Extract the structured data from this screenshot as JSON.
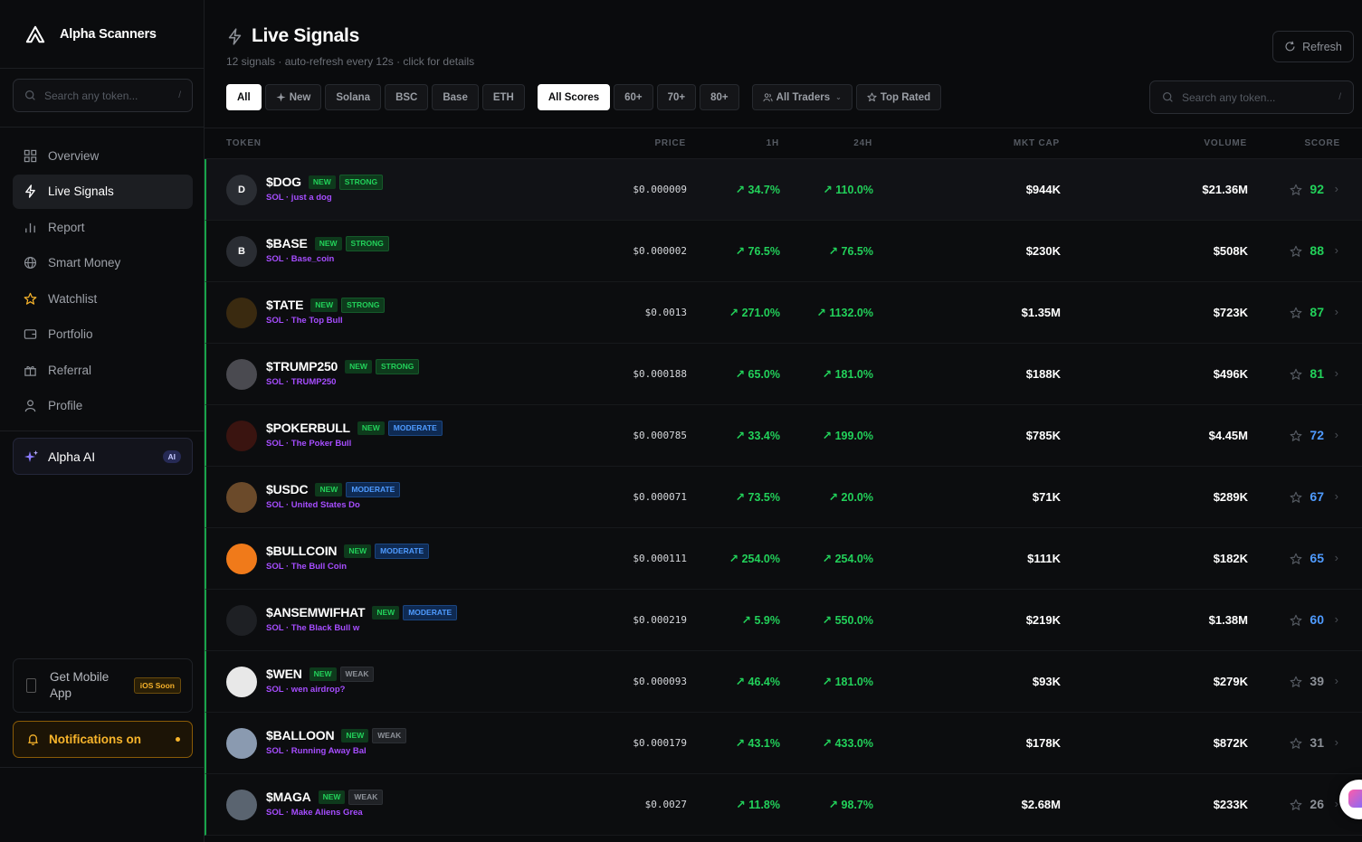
{
  "brand": {
    "name": "Alpha Scanners"
  },
  "sidebar": {
    "search_placeholder": "Search any token...",
    "search_kbd": "/",
    "nav": [
      {
        "label": "Overview",
        "icon": "grid-icon"
      },
      {
        "label": "Live Signals",
        "icon": "lightning-icon",
        "active": true
      },
      {
        "label": "Report",
        "icon": "bar-chart-icon"
      },
      {
        "label": "Smart Money",
        "icon": "globe-icon"
      },
      {
        "label": "Watchlist",
        "icon": "star-icon"
      },
      {
        "label": "Portfolio",
        "icon": "wallet-icon"
      },
      {
        "label": "Referral",
        "icon": "gift-icon"
      },
      {
        "label": "Profile",
        "icon": "user-icon"
      }
    ],
    "alpha_ai": {
      "label": "Alpha AI",
      "badge": "AI"
    },
    "mobile": {
      "label": "Get Mobile App",
      "badge": "iOS Soon"
    },
    "notifications": {
      "label": "Notifications on"
    }
  },
  "header": {
    "title": "Live Signals",
    "subtitle": "12 signals · auto-refresh every 12s · click for details",
    "refresh_label": "Refresh"
  },
  "filters": {
    "chains": [
      "All",
      "New",
      "Solana",
      "BSC",
      "Base",
      "ETH"
    ],
    "scores": [
      "All Scores",
      "60+",
      "70+",
      "80+"
    ],
    "traders": "All Traders",
    "top_rated": "Top Rated",
    "search_placeholder": "Search any token...",
    "search_kbd": "/"
  },
  "table": {
    "headers": {
      "token": "TOKEN",
      "price": "PRICE",
      "h1": "1H",
      "h24": "24H",
      "mcap": "MKT CAP",
      "volume": "VOLUME",
      "score": "SCORE"
    },
    "rows": [
      {
        "avatar": "D",
        "symbol": "$DOG",
        "new": "NEW",
        "strength": "STRONG",
        "sub": "SOL · just a dog",
        "price": "$0.000009",
        "h1": "↗ 34.7%",
        "h24": "↗ 110.0%",
        "mcap": "$944K",
        "volume": "$21.36M",
        "score": "92",
        "tier": "green"
      },
      {
        "avatar": "B",
        "symbol": "$BASE",
        "new": "NEW",
        "strength": "STRONG",
        "sub": "SOL · Base_coin",
        "price": "$0.000002",
        "h1": "↗ 76.5%",
        "h24": "↗ 76.5%",
        "mcap": "$230K",
        "volume": "$508K",
        "score": "88",
        "tier": "green"
      },
      {
        "avatar": "",
        "symbol": "$TATE",
        "new": "NEW",
        "strength": "STRONG",
        "sub": "SOL · The Top Bull",
        "price": "$0.0013",
        "h1": "↗ 271.0%",
        "h24": "↗ 1132.0%",
        "mcap": "$1.35M",
        "volume": "$723K",
        "score": "87",
        "tier": "green"
      },
      {
        "avatar": "",
        "symbol": "$TRUMP250",
        "new": "NEW",
        "strength": "STRONG",
        "sub": "SOL · TRUMP250",
        "price": "$0.000188",
        "h1": "↗ 65.0%",
        "h24": "↗ 181.0%",
        "mcap": "$188K",
        "volume": "$496K",
        "score": "81",
        "tier": "green"
      },
      {
        "avatar": "",
        "symbol": "$POKERBULL",
        "new": "NEW",
        "strength": "MODERATE",
        "sub": "SOL · The Poker Bull",
        "price": "$0.000785",
        "h1": "↗ 33.4%",
        "h24": "↗ 199.0%",
        "mcap": "$785K",
        "volume": "$4.45M",
        "score": "72",
        "tier": "blue"
      },
      {
        "avatar": "",
        "symbol": "$USDC",
        "new": "NEW",
        "strength": "MODERATE",
        "sub": "SOL · United States Do",
        "price": "$0.000071",
        "h1": "↗ 73.5%",
        "h24": "↗ 20.0%",
        "mcap": "$71K",
        "volume": "$289K",
        "score": "67",
        "tier": "blue"
      },
      {
        "avatar": "",
        "symbol": "$BULLCOIN",
        "new": "NEW",
        "strength": "MODERATE",
        "sub": "SOL · The Bull Coin",
        "price": "$0.000111",
        "h1": "↗ 254.0%",
        "h24": "↗ 254.0%",
        "mcap": "$111K",
        "volume": "$182K",
        "score": "65",
        "tier": "blue"
      },
      {
        "avatar": "",
        "symbol": "$ANSEMWIFHAT",
        "new": "NEW",
        "strength": "MODERATE",
        "sub": "SOL · The Black Bull w",
        "price": "$0.000219",
        "h1": "↗ 5.9%",
        "h24": "↗ 550.0%",
        "mcap": "$219K",
        "volume": "$1.38M",
        "score": "60",
        "tier": "blue"
      },
      {
        "avatar": "",
        "symbol": "$WEN",
        "new": "NEW",
        "strength": "WEAK",
        "sub": "SOL · wen airdrop?",
        "price": "$0.000093",
        "h1": "↗ 46.4%",
        "h24": "↗ 181.0%",
        "mcap": "$93K",
        "volume": "$279K",
        "score": "39",
        "tier": "gray"
      },
      {
        "avatar": "",
        "symbol": "$BALLOON",
        "new": "NEW",
        "strength": "WEAK",
        "sub": "SOL · Running Away Bal",
        "price": "$0.000179",
        "h1": "↗ 43.1%",
        "h24": "↗ 433.0%",
        "mcap": "$178K",
        "volume": "$872K",
        "score": "31",
        "tier": "gray"
      },
      {
        "avatar": "",
        "symbol": "$MAGA",
        "new": "NEW",
        "strength": "WEAK",
        "sub": "SOL · Make Aliens Grea",
        "price": "$0.0027",
        "h1": "↗ 11.8%",
        "h24": "↗ 98.7%",
        "mcap": "$2.68M",
        "volume": "$233K",
        "score": "26",
        "tier": "gray"
      }
    ]
  },
  "colors": {
    "accent_green": "#22d15a",
    "accent_blue": "#4f9bff",
    "purple": "#a64dff",
    "amber": "#f7b42b"
  }
}
